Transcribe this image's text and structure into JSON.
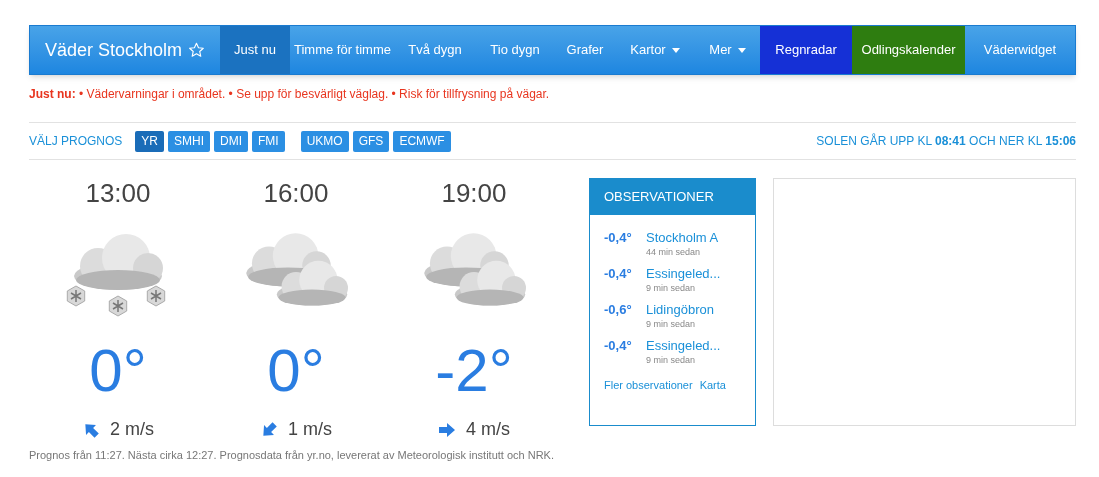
{
  "navbar": {
    "brand": "Väder Stockholm",
    "items": [
      {
        "label": "Just nu",
        "kind": "link",
        "selected": true
      },
      {
        "label": "Timme för timme",
        "kind": "link",
        "selected": false
      },
      {
        "label": "Två dygn",
        "kind": "link",
        "selected": false
      },
      {
        "label": "Tio dygn",
        "kind": "link",
        "selected": false
      },
      {
        "label": "Grafer",
        "kind": "link",
        "selected": false
      },
      {
        "label": "Kartor",
        "kind": "dropdown",
        "selected": false
      },
      {
        "label": "Mer",
        "kind": "dropdown",
        "selected": false
      },
      {
        "label": "Regnradar",
        "kind": "highlight",
        "color": "#1530d6",
        "selected": false
      },
      {
        "label": "Odlingskalender",
        "kind": "highlight",
        "color": "#2e7d10",
        "selected": false
      },
      {
        "label": "Väderwidget",
        "kind": "link",
        "selected": false
      }
    ]
  },
  "alert": "**Just nu:** • Vädervarningar i området. • Se upp för besvärligt väglag. • Risk för tillfrysning på vägar.",
  "forecast_picker": {
    "label": "VÄLJ PROGNOS",
    "groups": [
      [
        {
          "label": "YR",
          "selected": true
        },
        {
          "label": "SMHI",
          "selected": false
        },
        {
          "label": "DMI",
          "selected": false
        },
        {
          "label": "FMI",
          "selected": false
        }
      ],
      [
        {
          "label": "UKMO",
          "selected": false
        },
        {
          "label": "GFS",
          "selected": false
        },
        {
          "label": "ECMWF",
          "selected": false
        }
      ]
    ]
  },
  "sun": "SOLEN GÅR UPP KL **08:41** OCH NER KL **15:06**",
  "forecasts": [
    {
      "time": "13:00",
      "kind": "snow",
      "temperature": "0°",
      "wind": "2 m/s"
    },
    {
      "time": "16:00",
      "kind": "cloudy",
      "temperature": "0°",
      "wind": "1 m/s"
    },
    {
      "time": "19:00",
      "kind": "cloudy",
      "temperature": "-2°",
      "wind": "4 m/s"
    }
  ],
  "observations": {
    "title": "OBSERVATIONER",
    "items": [
      {
        "temperature": "-0,4°",
        "station": "Stockholm A",
        "age": "44 min sedan"
      },
      {
        "temperature": "-0,4°",
        "station": "Essingeled...",
        "age": "9 min sedan"
      },
      {
        "temperature": "-0,6°",
        "station": "Lidingöbron",
        "age": "9 min sedan"
      },
      {
        "temperature": "-0,4°",
        "station": "Essingeled...",
        "age": "9 min sedan"
      }
    ],
    "links": [
      "Fler observationer",
      "Karta"
    ]
  },
  "footer": "Prognos från 11:27. Nästa cirka 12:27. Prognosdata från yr.no, levererat av Meteorologisk institutt och NRK."
}
